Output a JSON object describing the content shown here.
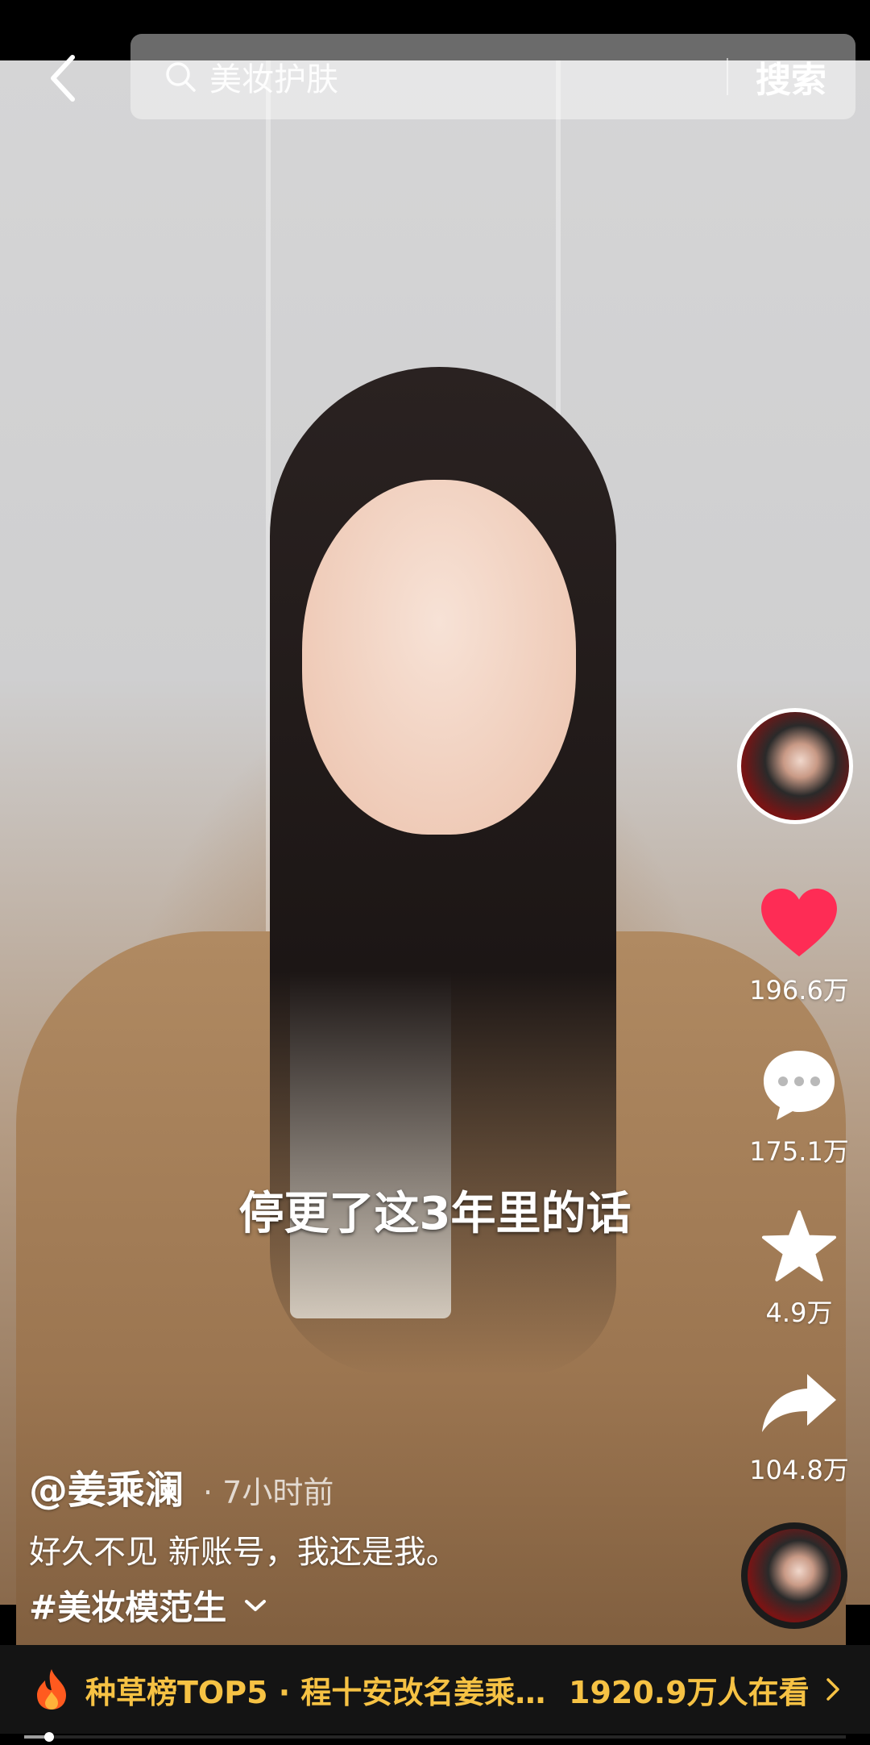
{
  "search": {
    "placeholder": "美妆护肤",
    "button_label": "搜索"
  },
  "video": {
    "subtitle": "停更了这3年里的话"
  },
  "rail": {
    "like_count": "196.6万",
    "comment_count": "175.1万",
    "favorite_count": "4.9万",
    "share_count": "104.8万",
    "like_color": "#fe2c55"
  },
  "caption": {
    "author": "@姜乘澜",
    "time": "· 7小时前",
    "description": "好久不见 新账号，我还是我。",
    "hashtag": "#美妆模范生"
  },
  "hotbar": {
    "title": "种草榜TOP5 · 程十安改名姜乘…",
    "viewers": "1920.9万人在看",
    "accent_color": "#f6c244"
  },
  "playback": {
    "progress": 0.03
  },
  "icons": [
    "back-arrow-icon",
    "search-icon",
    "heart-icon",
    "comment-icon",
    "star-icon",
    "share-icon",
    "chevron-down-icon",
    "fire-icon",
    "chevron-right-icon"
  ]
}
